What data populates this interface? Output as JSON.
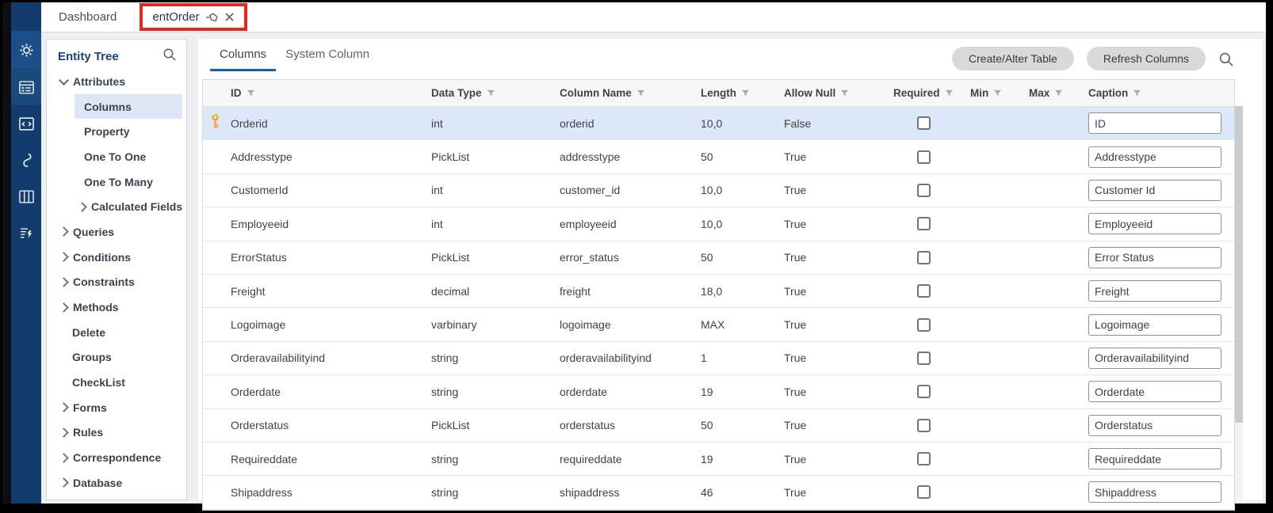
{
  "window": {
    "tabs": [
      {
        "label": "Dashboard"
      },
      {
        "label": "entOrder",
        "pinned": true,
        "closable": true,
        "highlighted_by_red_annotation": true
      }
    ]
  },
  "sidebar": {
    "icons": [
      "settings-gear",
      "entity-form",
      "code",
      "hook",
      "columns-layout",
      "script-actions"
    ]
  },
  "entity_tree": {
    "title": "Entity Tree",
    "search_icon": "search-icon",
    "items": [
      {
        "label": "Attributes",
        "level": 0,
        "state": "expanded"
      },
      {
        "label": "Columns",
        "level": 1,
        "selected": true
      },
      {
        "label": "Property",
        "level": 1
      },
      {
        "label": "One To One",
        "level": 1
      },
      {
        "label": "One To Many",
        "level": 1
      },
      {
        "label": "Calculated Fields",
        "level": 1,
        "state": "collapsed"
      },
      {
        "label": "Queries",
        "level": 0,
        "state": "collapsed"
      },
      {
        "label": "Conditions",
        "level": 0,
        "state": "collapsed"
      },
      {
        "label": "Constraints",
        "level": 0,
        "state": "collapsed"
      },
      {
        "label": "Methods",
        "level": 0,
        "state": "collapsed"
      },
      {
        "label": "Delete",
        "level": 0
      },
      {
        "label": "Groups",
        "level": 0
      },
      {
        "label": "CheckList",
        "level": 0
      },
      {
        "label": "Forms",
        "level": 0,
        "state": "collapsed"
      },
      {
        "label": "Rules",
        "level": 0,
        "state": "collapsed"
      },
      {
        "label": "Correspondence",
        "level": 0,
        "state": "collapsed"
      },
      {
        "label": "Database",
        "level": 0,
        "state": "collapsed"
      }
    ]
  },
  "main": {
    "tabs": [
      {
        "label": "Columns",
        "active": true
      },
      {
        "label": "System Column"
      }
    ],
    "buttons": [
      {
        "label": "Create/Alter Table"
      },
      {
        "label": "Refresh Columns"
      }
    ],
    "table": {
      "headers": [
        "ID",
        "Data Type",
        "Column Name",
        "Length",
        "Allow Null",
        "Required",
        "Min",
        "Max",
        "Caption"
      ],
      "rows": [
        {
          "id": "Orderid",
          "data_type": "int",
          "column_name": "orderid",
          "length": "10,0",
          "allow_null": "False",
          "required": false,
          "min": "",
          "max": "",
          "caption": "ID",
          "primary_key": true,
          "selected": true
        },
        {
          "id": "Addresstype",
          "data_type": "PickList",
          "column_name": "addresstype",
          "length": "50",
          "allow_null": "True",
          "required": false,
          "min": "",
          "max": "",
          "caption": "Addresstype"
        },
        {
          "id": "CustomerId",
          "data_type": "int",
          "column_name": "customer_id",
          "length": "10,0",
          "allow_null": "True",
          "required": false,
          "min": "",
          "max": "",
          "caption": "Customer Id"
        },
        {
          "id": "Employeeid",
          "data_type": "int",
          "column_name": "employeeid",
          "length": "10,0",
          "allow_null": "True",
          "required": false,
          "min": "",
          "max": "",
          "caption": "Employeeid"
        },
        {
          "id": "ErrorStatus",
          "data_type": "PickList",
          "column_name": "error_status",
          "length": "50",
          "allow_null": "True",
          "required": false,
          "min": "",
          "max": "",
          "caption": "Error Status"
        },
        {
          "id": "Freight",
          "data_type": "decimal",
          "column_name": "freight",
          "length": "18,0",
          "allow_null": "True",
          "required": false,
          "min": "",
          "max": "",
          "caption": "Freight"
        },
        {
          "id": "Logoimage",
          "data_type": "varbinary",
          "column_name": "logoimage",
          "length": "MAX",
          "allow_null": "True",
          "required": false,
          "min": "",
          "max": "",
          "caption": "Logoimage"
        },
        {
          "id": "Orderavailabilityind",
          "data_type": "string",
          "column_name": "orderavailabilityind",
          "length": "1",
          "allow_null": "True",
          "required": false,
          "min": "",
          "max": "",
          "caption": "Orderavailabilityind"
        },
        {
          "id": "Orderdate",
          "data_type": "string",
          "column_name": "orderdate",
          "length": "19",
          "allow_null": "True",
          "required": false,
          "min": "",
          "max": "",
          "caption": "Orderdate"
        },
        {
          "id": "Orderstatus",
          "data_type": "PickList",
          "column_name": "orderstatus",
          "length": "50",
          "allow_null": "True",
          "required": false,
          "min": "",
          "max": "",
          "caption": "Orderstatus"
        },
        {
          "id": "Requireddate",
          "data_type": "string",
          "column_name": "requireddate",
          "length": "19",
          "allow_null": "True",
          "required": false,
          "min": "",
          "max": "",
          "caption": "Requireddate"
        },
        {
          "id": "Shipaddress",
          "data_type": "string",
          "column_name": "shipaddress",
          "length": "46",
          "allow_null": "True",
          "required": false,
          "min": "",
          "max": "",
          "caption": "Shipaddress"
        }
      ]
    }
  },
  "colors": {
    "sidebar": "#123C6D",
    "sidebar_active_block": "#1D4E87",
    "selected_row": "#DCE7F7",
    "tree_selection": "#DCE6F5",
    "annotation_red": "#E12A1F",
    "primary_key_orange": "#F2A33C",
    "active_tab_underline": "#1A5CA8",
    "entity_tree_title": "#1C4077"
  }
}
